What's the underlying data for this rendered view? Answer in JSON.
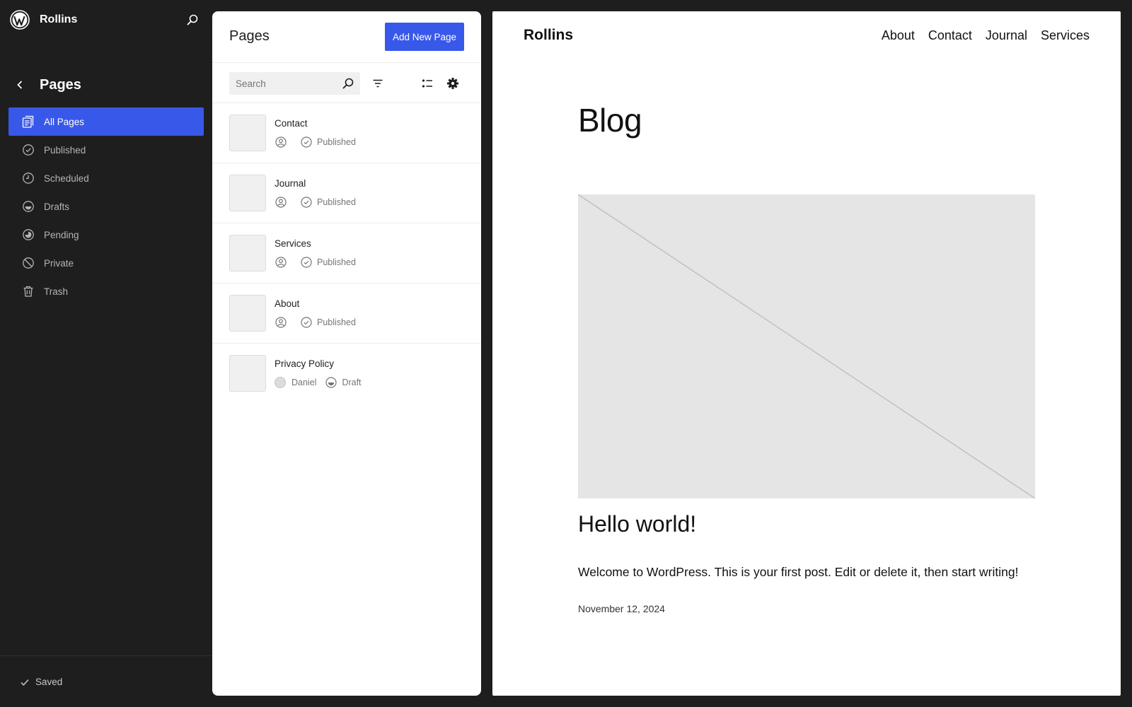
{
  "sidebar": {
    "site_name": "Rollins",
    "section_title": "Pages",
    "items": [
      {
        "label": "All Pages",
        "icon": "pages-icon",
        "active": true
      },
      {
        "label": "Published",
        "icon": "published-icon"
      },
      {
        "label": "Scheduled",
        "icon": "scheduled-icon"
      },
      {
        "label": "Drafts",
        "icon": "drafts-icon"
      },
      {
        "label": "Pending",
        "icon": "pending-icon"
      },
      {
        "label": "Private",
        "icon": "private-icon"
      },
      {
        "label": "Trash",
        "icon": "trash-icon"
      }
    ],
    "footer_status": "Saved"
  },
  "panel": {
    "title": "Pages",
    "add_button": "Add New Page",
    "search_placeholder": "Search",
    "rows": [
      {
        "title": "Contact",
        "author": "",
        "status": "Published"
      },
      {
        "title": "Journal",
        "author": "",
        "status": "Published"
      },
      {
        "title": "Services",
        "author": "",
        "status": "Published"
      },
      {
        "title": "About",
        "author": "",
        "status": "Published"
      },
      {
        "title": "Privacy Policy",
        "author": "Daniel",
        "status": "Draft"
      }
    ]
  },
  "preview": {
    "site_title": "Rollins",
    "nav": [
      "About",
      "Contact",
      "Journal",
      "Services"
    ],
    "heading": "Blog",
    "post_title": "Hello world!",
    "excerpt": "Welcome to WordPress. This is your first post. Edit or delete it, then start writing!",
    "date": "November 12, 2024"
  },
  "colors": {
    "accent": "#3858e9",
    "sidebar_bg": "#1e1e1e",
    "placeholder_image": "#e5e5e5"
  }
}
